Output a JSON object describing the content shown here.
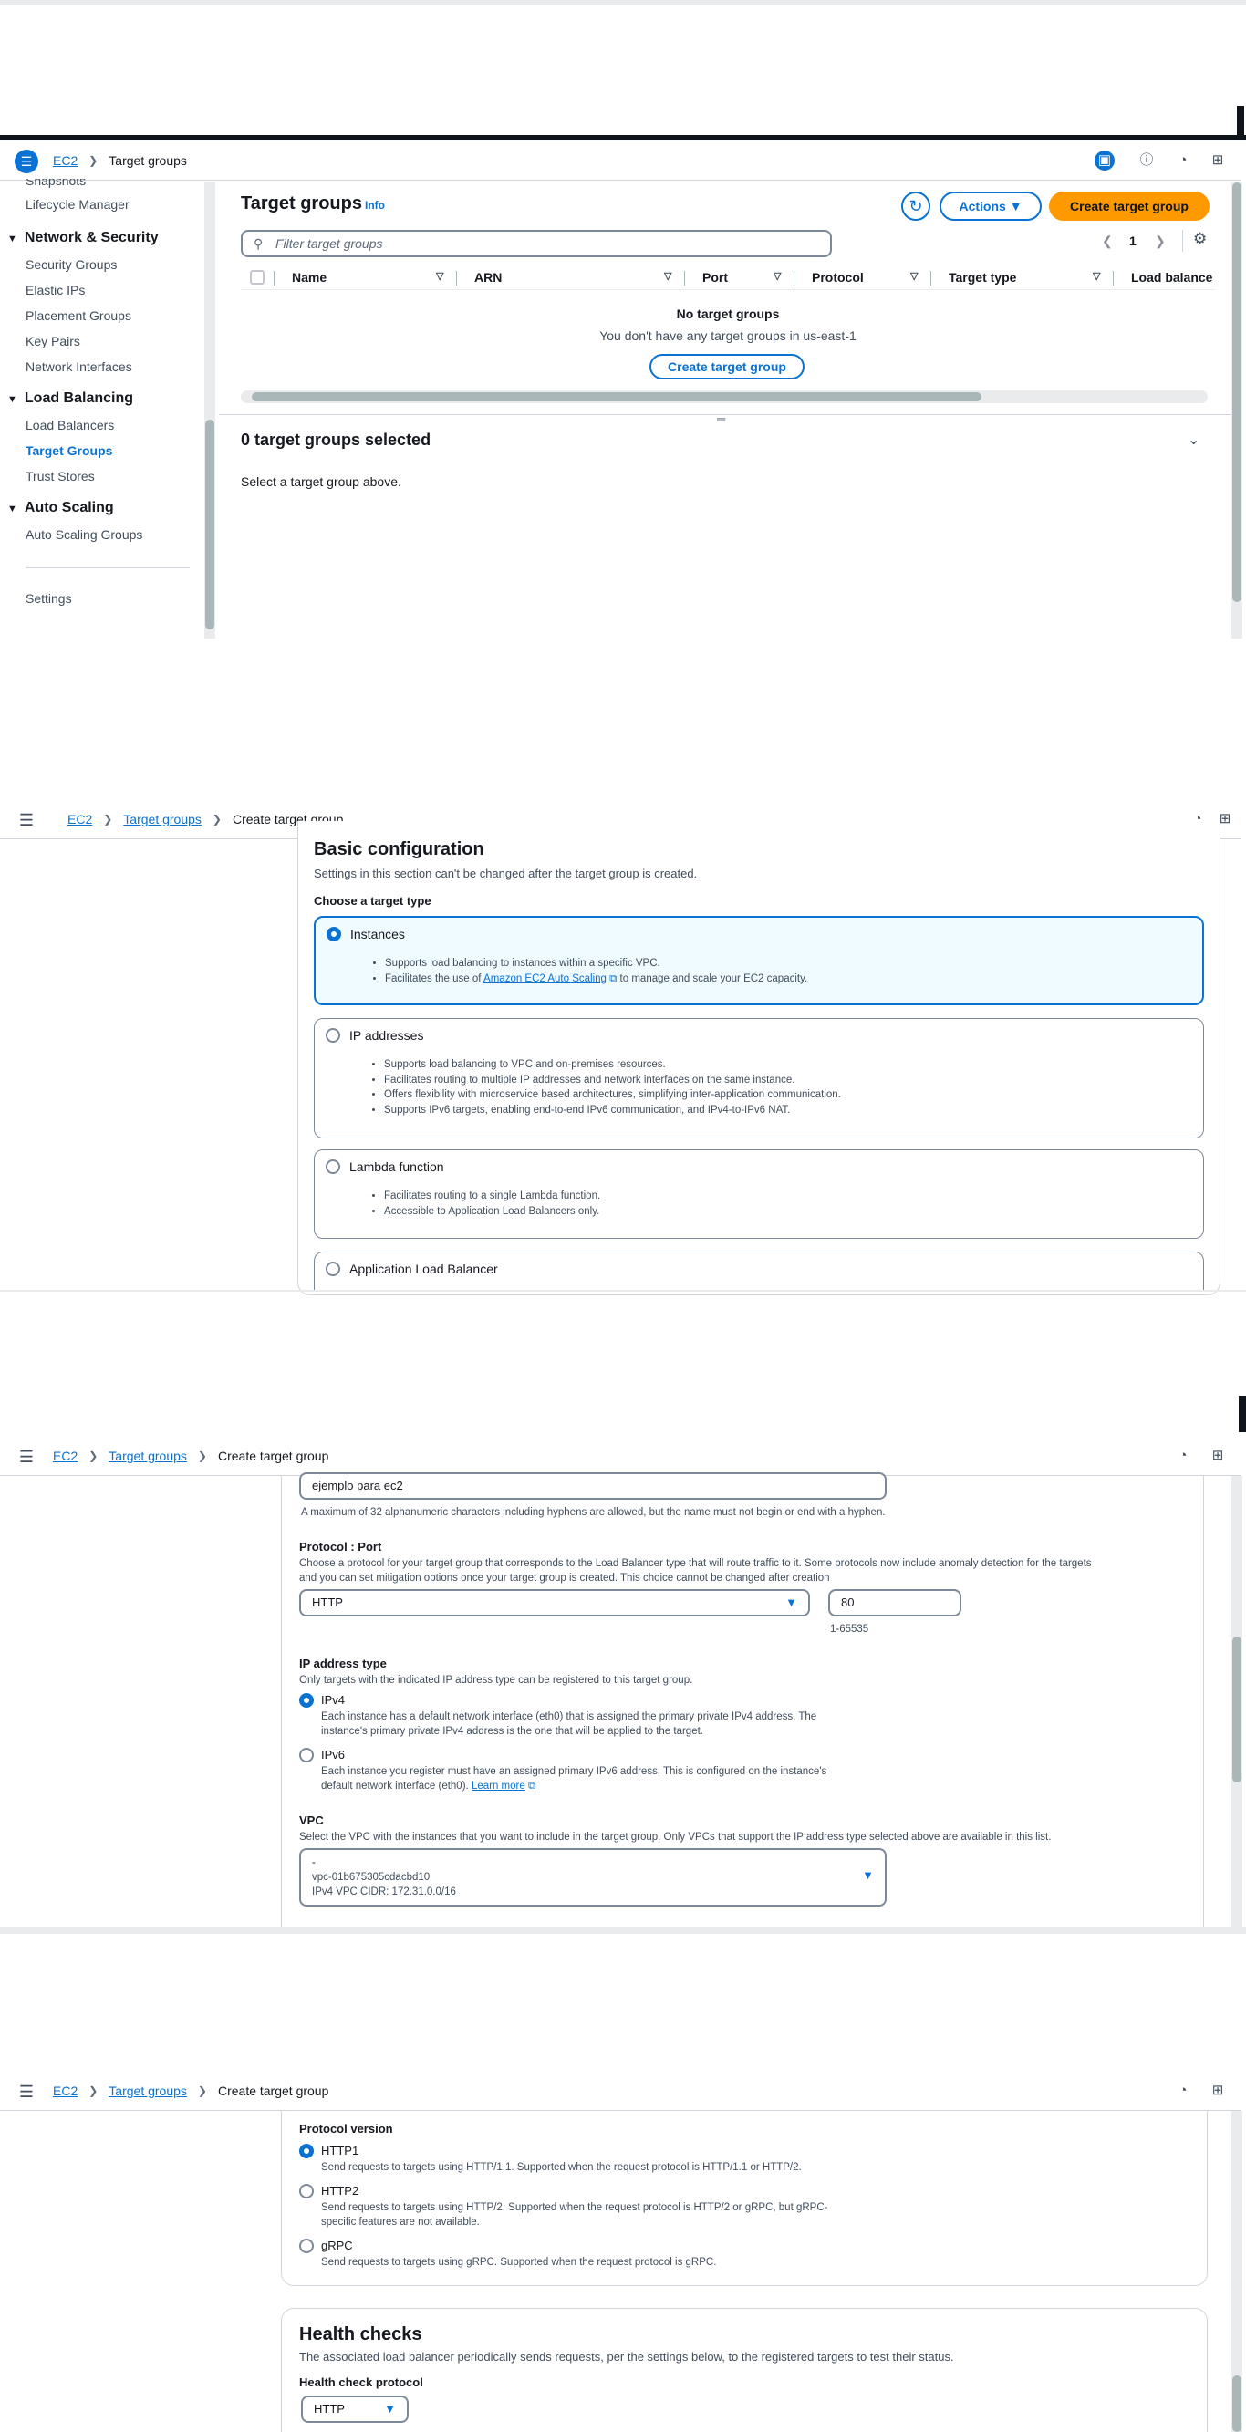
{
  "screen1": {
    "breadcrumb": [
      "EC2",
      "Target groups"
    ],
    "sidebar": {
      "cut_item": "Snapshots",
      "lifecycle": "Lifecycle Manager",
      "sections": [
        {
          "title": "Network & Security",
          "items": [
            "Security Groups",
            "Elastic IPs",
            "Placement Groups",
            "Key Pairs",
            "Network Interfaces"
          ]
        },
        {
          "title": "Load Balancing",
          "items": [
            "Load Balancers",
            "Target Groups",
            "Trust Stores"
          ]
        },
        {
          "title": "Auto Scaling",
          "items": [
            "Auto Scaling Groups"
          ]
        }
      ],
      "settings": "Settings"
    },
    "panel": {
      "title": "Target groups",
      "info": "Info",
      "actions": "Actions",
      "create": "Create target group",
      "search_placeholder": "Filter target groups",
      "page": "1",
      "columns": [
        "Name",
        "ARN",
        "Port",
        "Protocol",
        "Target type",
        "Load balance"
      ],
      "empty_title": "No target groups",
      "empty_desc": "You don't have any target groups in us-east-1",
      "empty_button": "Create target group",
      "selected_title": "0 target groups selected",
      "selected_desc": "Select a target group above."
    }
  },
  "form_breadcrumb": [
    "EC2",
    "Target groups",
    "Create target group"
  ],
  "screen2": {
    "heading": "Basic configuration",
    "desc": "Settings in this section can't be changed after the target group is created.",
    "choose_label": "Choose a target type",
    "options": [
      {
        "label": "Instances",
        "bullets": [
          "Supports load balancing to instances within a specific VPC."
        ],
        "b2_pre": "Facilitates the use of ",
        "b2_link": "Amazon EC2 Auto Scaling",
        "b2_post": " to manage and scale your EC2 capacity."
      },
      {
        "label": "IP addresses",
        "bullets": [
          "Supports load balancing to VPC and on-premises resources.",
          "Facilitates routing to multiple IP addresses and network interfaces on the same instance.",
          "Offers flexibility with microservice based architectures, simplifying inter-application communication.",
          "Supports IPv6 targets, enabling end-to-end IPv6 communication, and IPv4-to-IPv6 NAT."
        ]
      },
      {
        "label": "Lambda function",
        "bullets": [
          "Facilitates routing to a single Lambda function.",
          "Accessible to Application Load Balancers only."
        ]
      },
      {
        "label": "Application Load Balancer",
        "bullets": []
      }
    ]
  },
  "screen3": {
    "name_value": "ejemplo para ec2",
    "name_hint": "A maximum of 32 alphanumeric characters including hyphens are allowed, but the name must not begin or end with a hyphen.",
    "protocol_label": "Protocol : Port",
    "protocol_desc1": "Choose a protocol for your target group that corresponds to the Load Balancer type that will route traffic to it. Some protocols now include anomaly detection for the targets",
    "protocol_desc2": "and you can set mitigation options once your target group is created. This choice cannot be changed after creation",
    "protocol_value": "HTTP",
    "port_value": "80",
    "port_hint": "1-65535",
    "ip_label": "IP address type",
    "ip_desc": "Only targets with the indicated IP address type can be registered to this target group.",
    "ipv4_label": "IPv4",
    "ipv4_desc1": "Each instance has a default network interface (eth0) that is assigned the primary private IPv4 address. The",
    "ipv4_desc2": "instance's primary private IPv4 address is the one that will be applied to the target.",
    "ipv6_label": "IPv6",
    "ipv6_desc1": "Each instance you register must have an assigned primary IPv6 address. This is configured on the instance's",
    "ipv6_desc2": "default network interface (eth0).",
    "learn_more": "Learn more",
    "vpc_label": "VPC",
    "vpc_desc": "Select the VPC with the instances that you want to include in the target group. Only VPCs that support the IP address type selected above are available in this list.",
    "vpc_line1": "-",
    "vpc_line2": "vpc-01b675305cdacbd10",
    "vpc_line3": "IPv4 VPC CIDR: 172.31.0.0/16"
  },
  "screen4": {
    "version_label": "Protocol version",
    "versions": [
      {
        "label": "HTTP1",
        "desc": "Send requests to targets using HTTP/1.1. Supported when the request protocol is HTTP/1.1 or HTTP/2."
      },
      {
        "label": "HTTP2",
        "desc": "Send requests to targets using HTTP/2. Supported when the request protocol is HTTP/2 or gRPC, but gRPC-",
        "desc2": "specific features are not available."
      },
      {
        "label": "gRPC",
        "desc": "Send requests to targets using gRPC. Supported when the request protocol is gRPC."
      }
    ],
    "health_title": "Health checks",
    "health_desc": "The associated load balancer periodically sends requests, per the settings below, to the registered targets to test their status.",
    "health_proto_label": "Health check protocol",
    "health_proto_value": "HTTP"
  },
  "colors": {
    "accent": "#0972d3",
    "primary_button": "#ff9900",
    "selected_bg": "#f0fbff"
  }
}
